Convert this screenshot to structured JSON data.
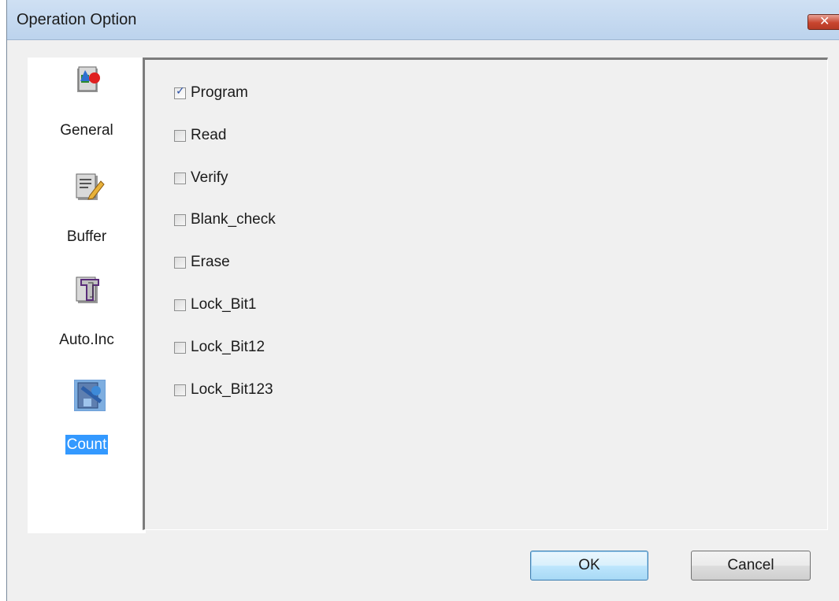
{
  "window": {
    "title": "Operation Option",
    "close_symbol": "✕"
  },
  "nav": {
    "items": [
      {
        "label": "General",
        "icon": "general-icon",
        "selected": false
      },
      {
        "label": "Buffer",
        "icon": "buffer-icon",
        "selected": false
      },
      {
        "label": "Auto.Inc",
        "icon": "auto-inc-icon",
        "selected": false
      },
      {
        "label": "Count",
        "icon": "count-icon",
        "selected": true
      }
    ]
  },
  "options": [
    {
      "label": "Program",
      "checked": true
    },
    {
      "label": "Read",
      "checked": false
    },
    {
      "label": "Verify",
      "checked": false
    },
    {
      "label": "Blank_check",
      "checked": false
    },
    {
      "label": "Erase",
      "checked": false
    },
    {
      "label": "Lock_Bit1",
      "checked": false
    },
    {
      "label": "Lock_Bit12",
      "checked": false
    },
    {
      "label": "Lock_Bit123",
      "checked": false
    }
  ],
  "buttons": {
    "ok": "OK",
    "cancel": "Cancel"
  },
  "colors": {
    "selection": "#3399ff",
    "titlebar": "#bcd3ed",
    "close": "#c8452f"
  }
}
